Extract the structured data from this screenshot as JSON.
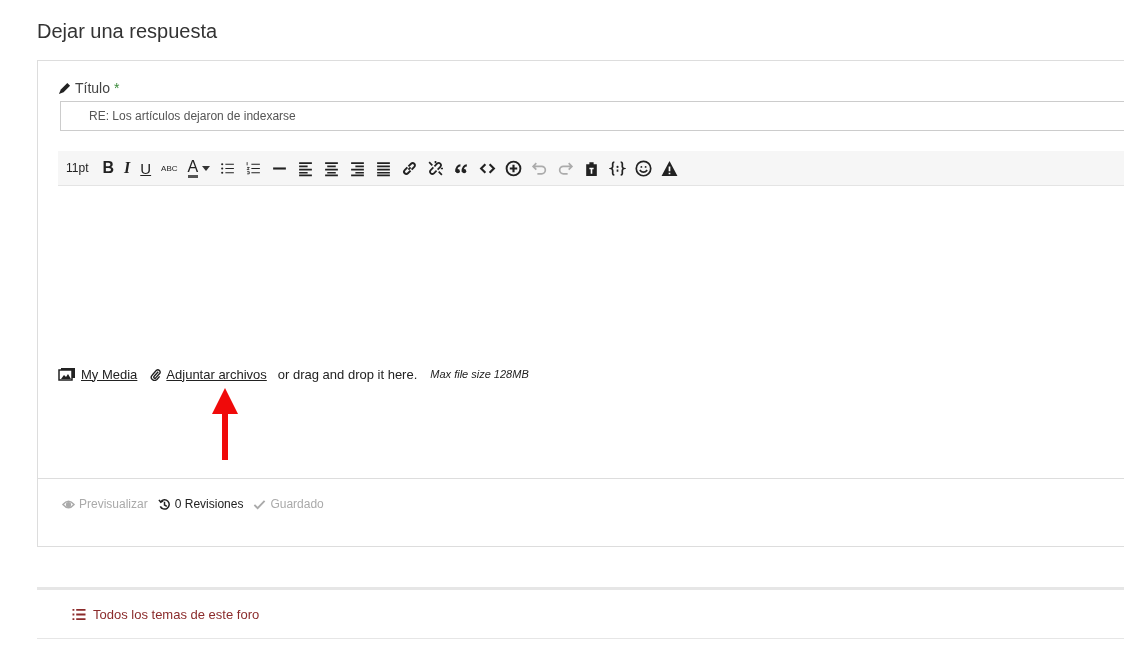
{
  "heading": "Dejar una respuesta",
  "title_field": {
    "label": "Título",
    "required_mark": "*",
    "value": "RE: Los artículos dejaron de indexarse"
  },
  "toolbar": [
    {
      "kind": "text",
      "label": "11pt",
      "disabled": false
    },
    {
      "kind": "bold",
      "label": "B",
      "disabled": false
    },
    {
      "kind": "italic",
      "label": "I",
      "disabled": false
    },
    {
      "kind": "underline",
      "label": "U",
      "disabled": false
    },
    {
      "kind": "strike",
      "label": "ABC",
      "disabled": false
    },
    {
      "kind": "color",
      "label": "A",
      "disabled": false
    },
    {
      "kind": "bullet-list",
      "disabled": false
    },
    {
      "kind": "numbered-list",
      "disabled": false
    },
    {
      "kind": "rule",
      "disabled": false
    },
    {
      "kind": "align-left",
      "disabled": false
    },
    {
      "kind": "align-center",
      "disabled": false
    },
    {
      "kind": "align-right",
      "disabled": false
    },
    {
      "kind": "justify",
      "disabled": false
    },
    {
      "kind": "link",
      "disabled": false
    },
    {
      "kind": "unlink",
      "disabled": false
    },
    {
      "kind": "quote",
      "disabled": false
    },
    {
      "kind": "code",
      "disabled": false
    },
    {
      "kind": "insert",
      "disabled": false
    },
    {
      "kind": "undo",
      "disabled": true
    },
    {
      "kind": "redo",
      "disabled": true
    },
    {
      "kind": "paste",
      "disabled": false
    },
    {
      "kind": "braces",
      "disabled": false
    },
    {
      "kind": "emoji",
      "disabled": false
    },
    {
      "kind": "warning",
      "disabled": false
    }
  ],
  "attachments": {
    "media_link": "My Media",
    "attach_link": "Adjuntar archivos",
    "hint": "or drag and drop it here.",
    "max_size": "Max file size 128MB"
  },
  "footer_actions": [
    {
      "kind": "preview",
      "label": "Previsualizar",
      "disabled": true
    },
    {
      "kind": "revisions",
      "label": "0 Revisiones",
      "disabled": false
    },
    {
      "kind": "saved",
      "label": "Guardado",
      "disabled": true
    }
  ],
  "forum_link": "Todos los temas de este foro"
}
